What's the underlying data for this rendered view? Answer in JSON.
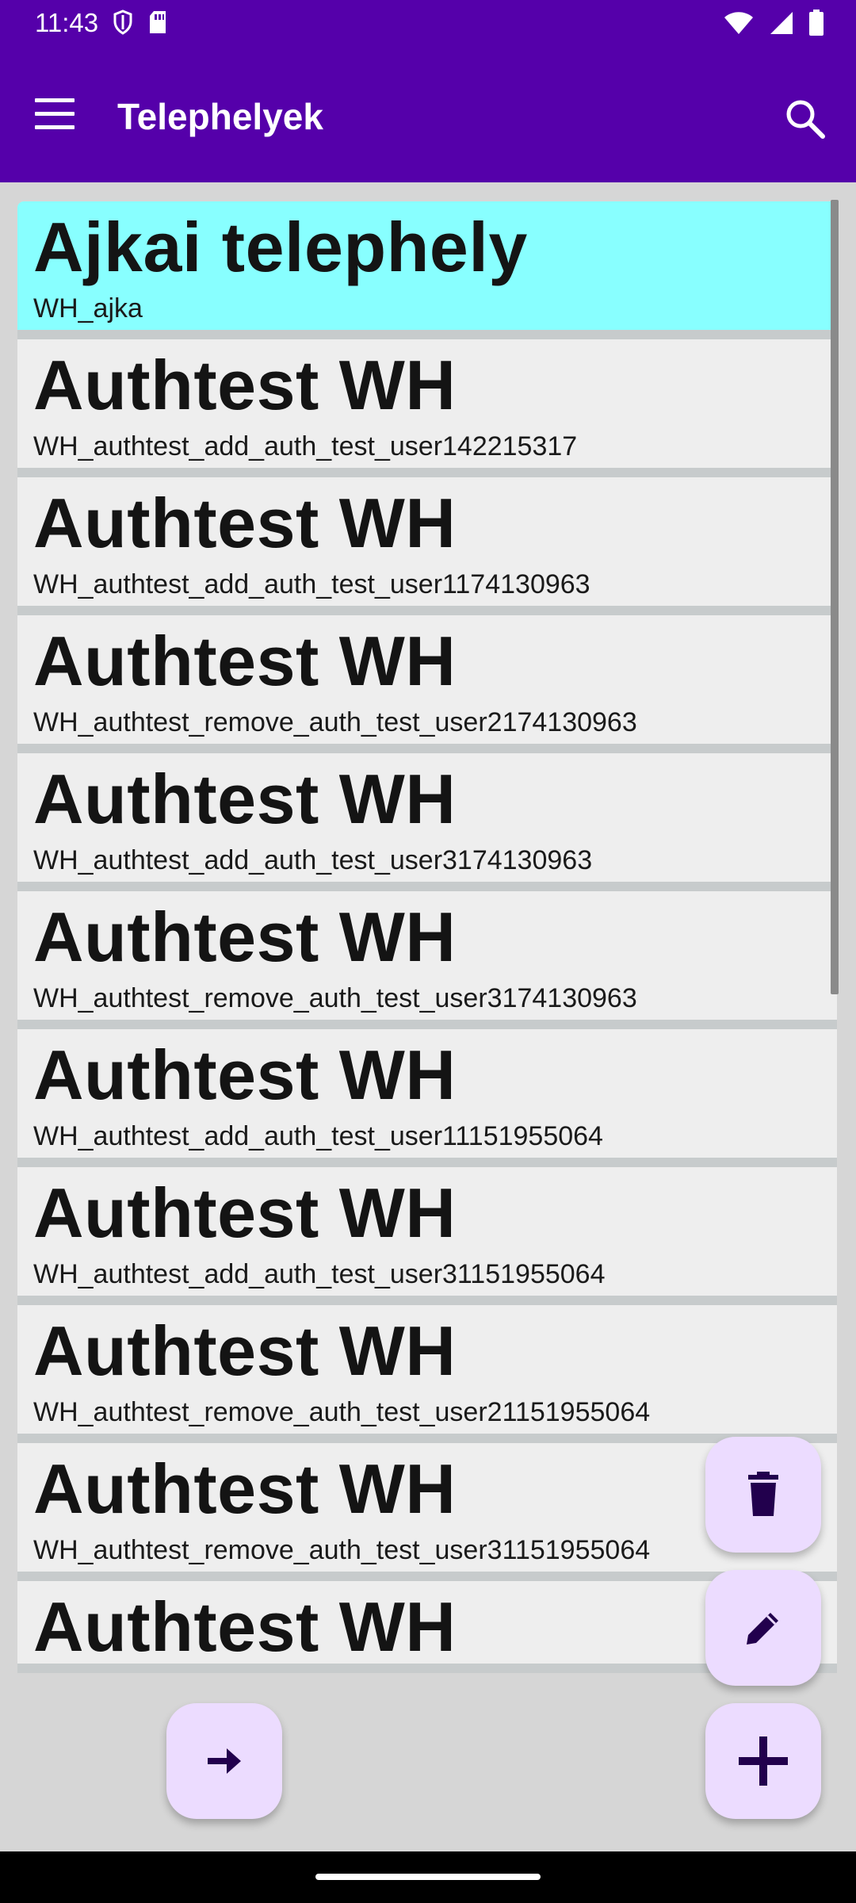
{
  "status_bar": {
    "time": "11:43",
    "left_icons": [
      "shield-icon",
      "sd-card-icon"
    ],
    "right_icons": [
      "wifi-icon",
      "signal-icon",
      "battery-icon"
    ]
  },
  "app_bar": {
    "title": "Telephelyek",
    "background_color": "#5500aa"
  },
  "list": {
    "items": [
      {
        "title": "Ajkai telephely",
        "code": "WH_ajka",
        "selected": true
      },
      {
        "title": "Authtest WH",
        "code": "WH_authtest_add_auth_test_user142215317"
      },
      {
        "title": "Authtest WH",
        "code": "WH_authtest_add_auth_test_user1174130963"
      },
      {
        "title": "Authtest WH",
        "code": "WH_authtest_remove_auth_test_user2174130963"
      },
      {
        "title": "Authtest WH",
        "code": "WH_authtest_add_auth_test_user3174130963"
      },
      {
        "title": "Authtest WH",
        "code": "WH_authtest_remove_auth_test_user3174130963"
      },
      {
        "title": "Authtest WH",
        "code": "WH_authtest_add_auth_test_user11151955064"
      },
      {
        "title": "Authtest WH",
        "code": "WH_authtest_add_auth_test_user31151955064"
      },
      {
        "title": "Authtest WH",
        "code": "WH_authtest_remove_auth_test_user21151955064"
      },
      {
        "title": "Authtest WH",
        "code": "WH_authtest_remove_auth_test_user31151955064"
      },
      {
        "title": "Authtest WH",
        "code": ""
      }
    ],
    "selected_color": "#88ffff"
  },
  "fabs": {
    "delete_icon": "trash-icon",
    "edit_icon": "pencil-icon",
    "add_icon": "plus-icon",
    "next_icon": "arrow-right-icon",
    "fab_color": "#ecdcff"
  }
}
